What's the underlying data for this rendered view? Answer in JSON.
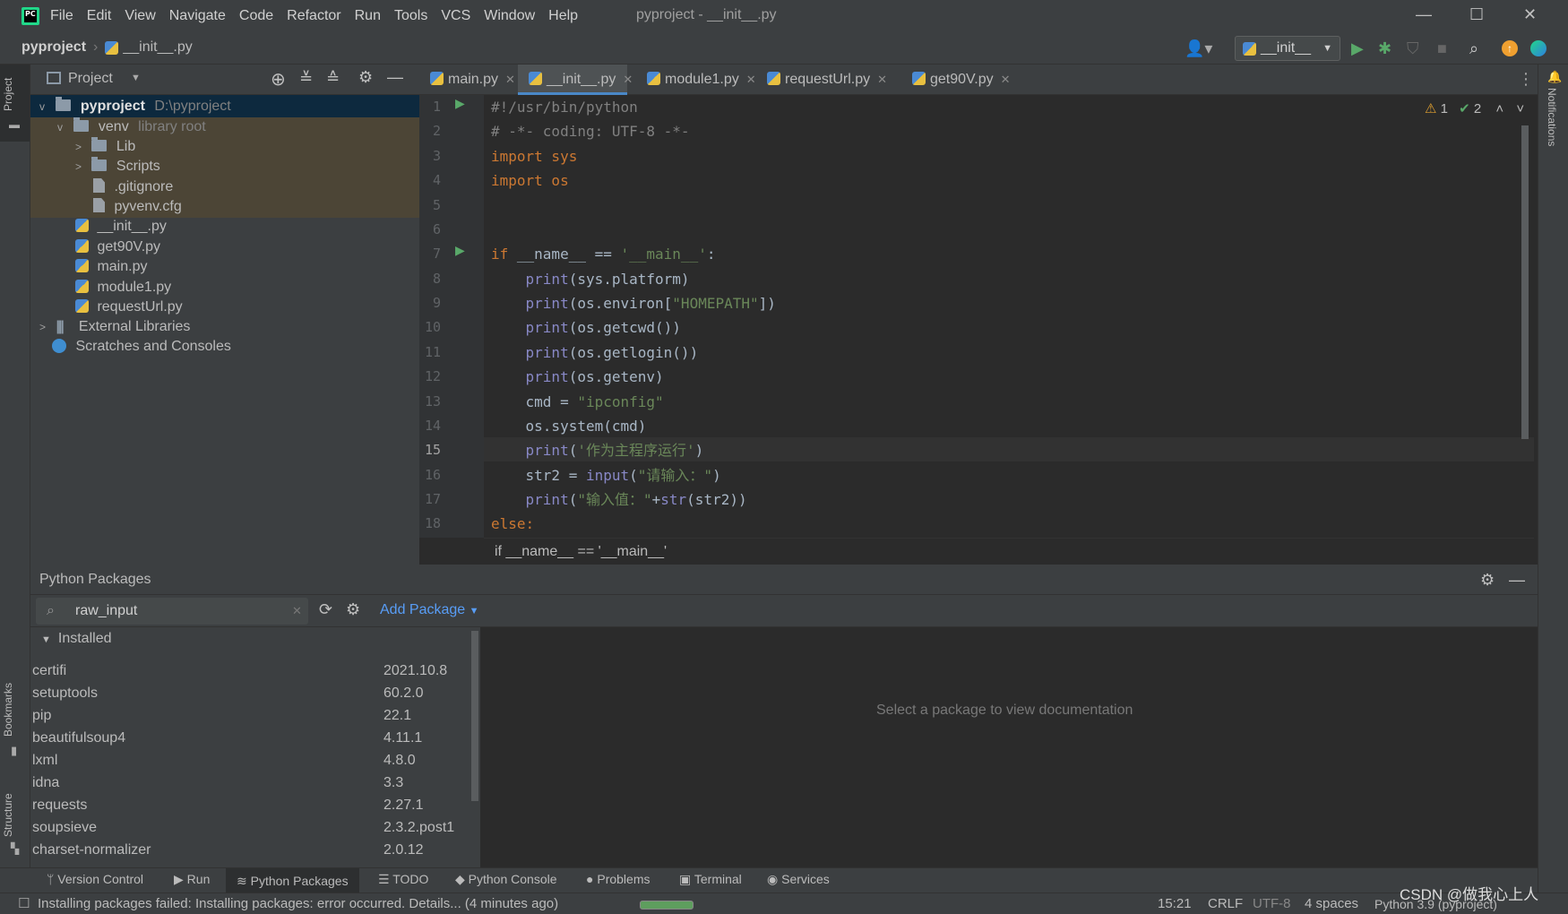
{
  "app": {
    "title": "pyproject - __init__.py",
    "menu": [
      "File",
      "Edit",
      "View",
      "Navigate",
      "Code",
      "Refactor",
      "Run",
      "Tools",
      "VCS",
      "Window",
      "Help"
    ]
  },
  "navbar": {
    "project": "pyproject",
    "file": "__init__.py",
    "run_config": "__init__"
  },
  "project_panel": {
    "title": "Project",
    "tree": [
      {
        "label": "pyproject",
        "extra": "D:\\pyproject",
        "kind": "folder",
        "chev": "v",
        "depth": 0
      },
      {
        "label": "venv",
        "extra": "library root",
        "kind": "folder",
        "chev": "v",
        "depth": 1
      },
      {
        "label": "Lib",
        "extra": "",
        "kind": "folder",
        "chev": ">",
        "depth": 2
      },
      {
        "label": "Scripts",
        "extra": "",
        "kind": "folder",
        "chev": ">",
        "depth": 2
      },
      {
        "label": ".gitignore",
        "extra": "",
        "kind": "file",
        "chev": "",
        "depth": 2
      },
      {
        "label": "pyvenv.cfg",
        "extra": "",
        "kind": "file",
        "chev": "",
        "depth": 2
      },
      {
        "label": "__init__.py",
        "extra": "",
        "kind": "py",
        "chev": "",
        "depth": 1
      },
      {
        "label": "get90V.py",
        "extra": "",
        "kind": "py",
        "chev": "",
        "depth": 1
      },
      {
        "label": "main.py",
        "extra": "",
        "kind": "py",
        "chev": "",
        "depth": 1
      },
      {
        "label": "module1.py",
        "extra": "",
        "kind": "py",
        "chev": "",
        "depth": 1
      },
      {
        "label": "requestUrl.py",
        "extra": "",
        "kind": "py",
        "chev": "",
        "depth": 1
      },
      {
        "label": "External Libraries",
        "extra": "",
        "kind": "lib",
        "chev": ">",
        "depth": 0
      },
      {
        "label": "Scratches and Consoles",
        "extra": "",
        "kind": "scratch",
        "chev": "",
        "depth": 0
      }
    ]
  },
  "editor_tabs": [
    "main.py",
    "__init__.py",
    "module1.py",
    "requestUrl.py",
    "get90V.py"
  ],
  "inspections": {
    "warnings": "1",
    "ok": "2"
  },
  "code_lines": [
    "#!/usr/bin/python",
    "# -*- coding: UTF-8 -*-",
    "import sys",
    "import os",
    "",
    "",
    "if __name__ == '__main__':",
    "    print(sys.platform)",
    "    print(os.environ[\"HOMEPATH\"])",
    "    print(os.getcwd())",
    "    print(os.getlogin())",
    "    print(os.getenv)",
    "    cmd = \"ipconfig\"",
    "    os.system(cmd)",
    "    print('作为主程序运行')",
    "    str2 = input(\"请输入：\")",
    "    print(\"输入值：\"+str(str2))",
    "else:"
  ],
  "editor_breadcrumb": "if __name__ == '__main__'",
  "packages": {
    "title": "Python Packages",
    "search_value": "raw_input",
    "add_package": "Add Package",
    "installed_label": "Installed",
    "list": [
      {
        "name": "certifi",
        "version": "2021.10.8"
      },
      {
        "name": "setuptools",
        "version": "60.2.0"
      },
      {
        "name": "pip",
        "version": "22.1"
      },
      {
        "name": "beautifulsoup4",
        "version": "4.11.1"
      },
      {
        "name": "lxml",
        "version": "4.8.0"
      },
      {
        "name": "idna",
        "version": "3.3"
      },
      {
        "name": "requests",
        "version": "2.27.1"
      },
      {
        "name": "soupsieve",
        "version": "2.3.2.post1"
      },
      {
        "name": "charset-normalizer",
        "version": "2.0.12"
      }
    ],
    "doc_placeholder": "Select a package to view documentation"
  },
  "side_labels": {
    "project": "Project",
    "bookmarks": "Bookmarks",
    "structure": "Structure",
    "notifications": "Notifications"
  },
  "bottom_tabs": [
    "Version Control",
    "Run",
    "Python Packages",
    "TODO",
    "Python Console",
    "Problems",
    "Terminal",
    "Services"
  ],
  "status": {
    "message": "Installing packages failed: Installing packages: error occurred. Details... (4 minutes ago)",
    "position": "15:21",
    "line_sep": "CRLF",
    "encoding": "UTF-8",
    "indent": "4 spaces",
    "interpreter": "Python 3.9 (pyproject)",
    "watermark": "CSDN @做我心上人"
  },
  "colors": {
    "accent": "#4a88c7",
    "keyword": "#cc7832",
    "string": "#6a8759",
    "builtin": "#8888c6",
    "comment": "#808080"
  }
}
